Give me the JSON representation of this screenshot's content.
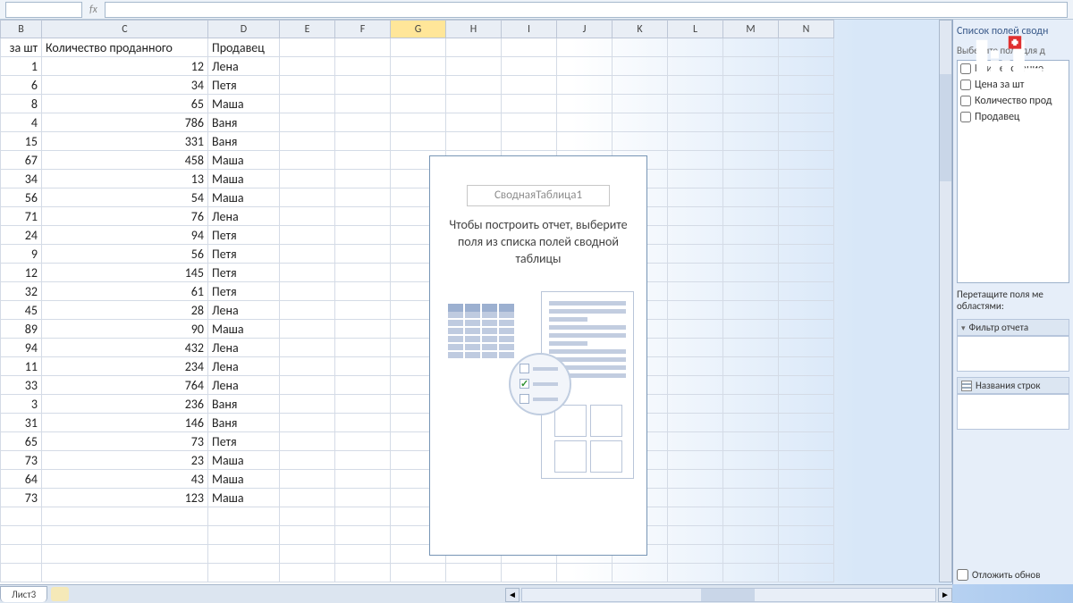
{
  "formula": {
    "fx_label": "fx",
    "value": ""
  },
  "columns": [
    "B",
    "C",
    "D",
    "E",
    "F",
    "G",
    "H",
    "I",
    "J",
    "K",
    "L",
    "M",
    "N"
  ],
  "headers": {
    "B": "за шт",
    "C": "Количество проданного",
    "D": "Продавец"
  },
  "rows": [
    {
      "b": 1,
      "c": 12,
      "d": "Лена"
    },
    {
      "b": 6,
      "c": 34,
      "d": "Петя"
    },
    {
      "b": 8,
      "c": 65,
      "d": "Маша"
    },
    {
      "b": 4,
      "c": 786,
      "d": "Ваня"
    },
    {
      "b": 15,
      "c": 331,
      "d": "Ваня"
    },
    {
      "b": 67,
      "c": 458,
      "d": "Маша"
    },
    {
      "b": 34,
      "c": 13,
      "d": "Маша"
    },
    {
      "b": 56,
      "c": 54,
      "d": "Маша"
    },
    {
      "b": 71,
      "c": 76,
      "d": "Лена"
    },
    {
      "b": 24,
      "c": 94,
      "d": "Петя"
    },
    {
      "b": 9,
      "c": 56,
      "d": "Петя"
    },
    {
      "b": 12,
      "c": 145,
      "d": "Петя"
    },
    {
      "b": 32,
      "c": 61,
      "d": "Петя"
    },
    {
      "b": 45,
      "c": 28,
      "d": "Лена"
    },
    {
      "b": 89,
      "c": 90,
      "d": "Маша"
    },
    {
      "b": 94,
      "c": 432,
      "d": "Лена"
    },
    {
      "b": 11,
      "c": 234,
      "d": "Лена"
    },
    {
      "b": 33,
      "c": 764,
      "d": "Лена"
    },
    {
      "b": 3,
      "c": 236,
      "d": "Ваня"
    },
    {
      "b": 31,
      "c": 146,
      "d": "Ваня"
    },
    {
      "b": 65,
      "c": 73,
      "d": "Петя"
    },
    {
      "b": 73,
      "c": 23,
      "d": "Маша"
    },
    {
      "b": 64,
      "c": 43,
      "d": "Маша"
    },
    {
      "b": 73,
      "c": 123,
      "d": "Маша"
    }
  ],
  "pivot": {
    "name": "СводнаяТаблица1",
    "instruction": "Чтобы построить отчет, выберите поля из списка полей сводной таблицы"
  },
  "panel": {
    "title": "Список полей сводн",
    "choose_fields": "Выберите поля для д",
    "fields": [
      "Наименование",
      "Цена за шт",
      "Количество прод",
      "Продавец"
    ],
    "drag_instr": "Перетащите поля ме",
    "drag_instr2": "областями:",
    "area_filter": "Фильтр отчета",
    "area_rows": "Названия строк",
    "defer": "Отложить обнов"
  },
  "sheet_tab": "Лист3"
}
